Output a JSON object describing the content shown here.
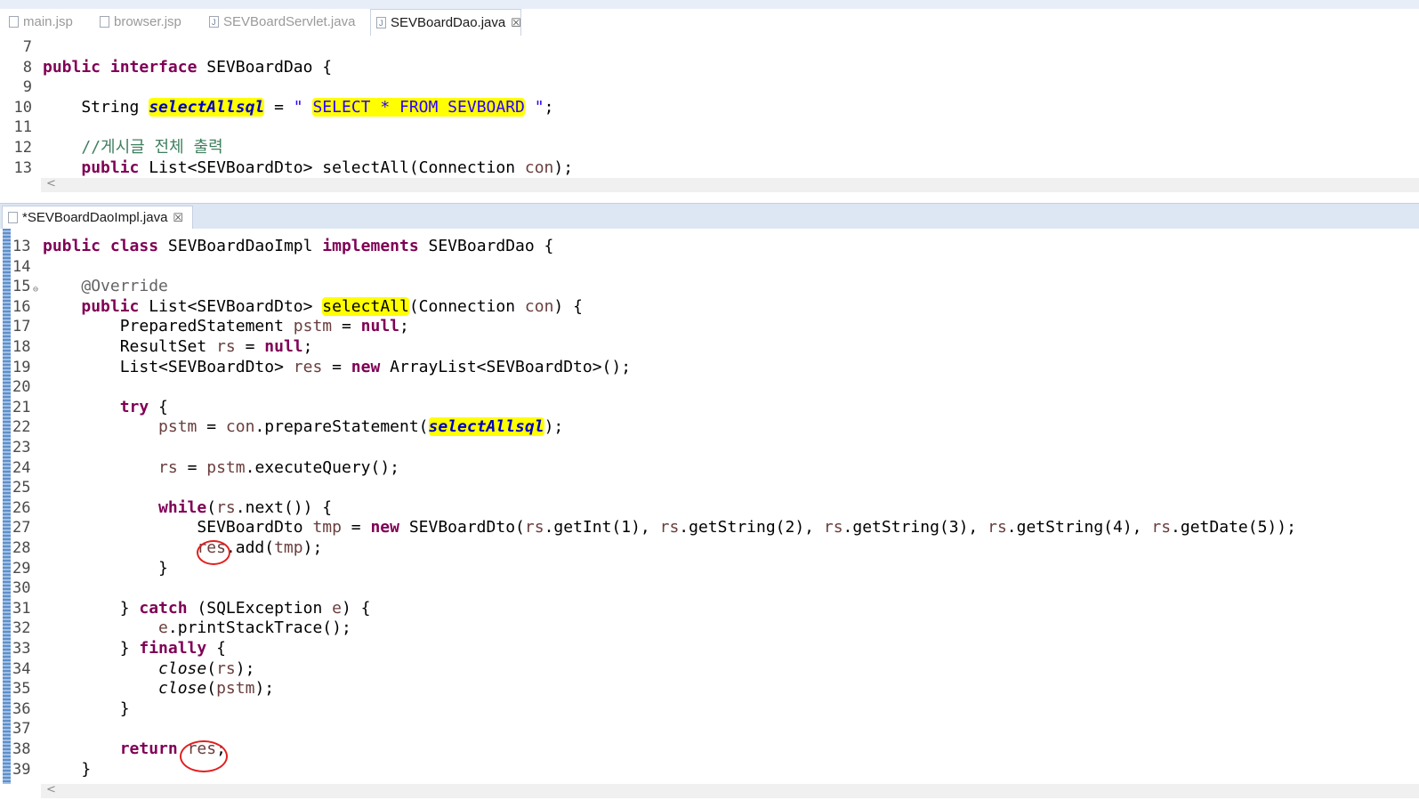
{
  "editor_top": {
    "tabs": [
      {
        "label": "main.jsp",
        "active": false,
        "icon": "jsp-file-icon"
      },
      {
        "label": "browser.jsp",
        "active": false,
        "icon": "jsp-file-icon"
      },
      {
        "label": "SEVBoardServlet.java",
        "active": false,
        "icon": "java-file-icon"
      },
      {
        "label": "SEVBoardDao.java",
        "active": true,
        "icon": "java-file-icon",
        "close": "☒"
      }
    ],
    "lines": [
      {
        "n": "7",
        "html": ""
      },
      {
        "n": "8",
        "html": "<span class='kw'>public</span> <span class='kw'>interface</span> SEVBoardDao {"
      },
      {
        "n": "9",
        "html": ""
      },
      {
        "n": "10",
        "html": "    String <span class='fld hl'>selectAllsql</span> = <span class='str'>\" <span class='hl'>SELECT * FROM SEVBOARD</span> \"</span>;"
      },
      {
        "n": "11",
        "html": ""
      },
      {
        "n": "12",
        "html": "    <span class='cm'>//게시글 전체 출력</span>"
      },
      {
        "n": "13",
        "html": "    <span class='kw'>public</span> List&lt;SEVBoardDto&gt; selectAll(Connection <span class='var'>con</span>);"
      }
    ]
  },
  "editor_bottom": {
    "tab": {
      "label": "*SEVBoardDaoImpl.java",
      "icon": "java-file-icon",
      "close": "☒"
    },
    "lines": [
      {
        "n": "13",
        "html": "<span class='kw'>public</span> <span class='kw'>class</span> SEVBoardDaoImpl <span class='kw'>implements</span> SEVBoardDao {"
      },
      {
        "n": "14",
        "html": ""
      },
      {
        "n": "15",
        "html": "    <span class='ann'>@Override</span>",
        "fold": "⊖"
      },
      {
        "n": "16",
        "html": "    <span class='kw'>public</span> List&lt;SEVBoardDto&gt; <span class='hl'>selectAll</span>(Connection <span class='var'>con</span>) {"
      },
      {
        "n": "17",
        "html": "        PreparedStatement <span class='var'>pstm</span> = <span class='kw'>null</span>;"
      },
      {
        "n": "18",
        "html": "        ResultSet <span class='var'>rs</span> = <span class='kw'>null</span>;"
      },
      {
        "n": "19",
        "html": "        List&lt;SEVBoardDto&gt; <span class='var'>res</span> = <span class='kw'>new</span> ArrayList&lt;SEVBoardDto&gt;();"
      },
      {
        "n": "20",
        "html": ""
      },
      {
        "n": "21",
        "html": "        <span class='kw'>try</span> {"
      },
      {
        "n": "22",
        "html": "            <span class='var'>pstm</span> = <span class='var'>con</span>.prepareStatement(<span class='fld hl'>selectAllsql</span>);"
      },
      {
        "n": "23",
        "html": ""
      },
      {
        "n": "24",
        "html": "            <span class='var'>rs</span> = <span class='var'>pstm</span>.executeQuery();"
      },
      {
        "n": "25",
        "html": ""
      },
      {
        "n": "26",
        "html": "            <span class='kw'>while</span>(<span class='var'>rs</span>.next()) {"
      },
      {
        "n": "27",
        "html": "                SEVBoardDto <span class='var'>tmp</span> = <span class='kw'>new</span> SEVBoardDto(<span class='var'>rs</span>.getInt(1), <span class='var'>rs</span>.getString(2), <span class='var'>rs</span>.getString(3), <span class='var'>rs</span>.getString(4), <span class='var'>rs</span>.getDate(5));"
      },
      {
        "n": "28",
        "html": "                <span class='var'>res</span>.add(<span class='var'>tmp</span>);"
      },
      {
        "n": "29",
        "html": "            }"
      },
      {
        "n": "30",
        "html": ""
      },
      {
        "n": "31",
        "html": "        } <span class='kw'>catch</span> (SQLException <span class='var'>e</span>) {"
      },
      {
        "n": "32",
        "html": "            <span class='var'>e</span>.printStackTrace();"
      },
      {
        "n": "33",
        "html": "        } <span class='kw'>finally</span> {"
      },
      {
        "n": "34",
        "html": "            <span class='it'>close</span>(<span class='var'>rs</span>);"
      },
      {
        "n": "35",
        "html": "            <span class='it'>close</span>(<span class='var'>pstm</span>);"
      },
      {
        "n": "36",
        "html": "        }"
      },
      {
        "n": "37",
        "html": ""
      },
      {
        "n": "38",
        "html": "        <span class='kw'>return</span> <span class='var'>res</span>;"
      },
      {
        "n": "39",
        "html": "    }"
      }
    ]
  },
  "scroll_arrow": "<",
  "colors": {
    "keyword": "#7f0055",
    "string": "#2a00ff",
    "local_var": "#6a3e3e",
    "field": "#0000c0",
    "comment": "#3f7f5f",
    "highlight": "#ffff00",
    "annotation_circle": "#e02020"
  }
}
